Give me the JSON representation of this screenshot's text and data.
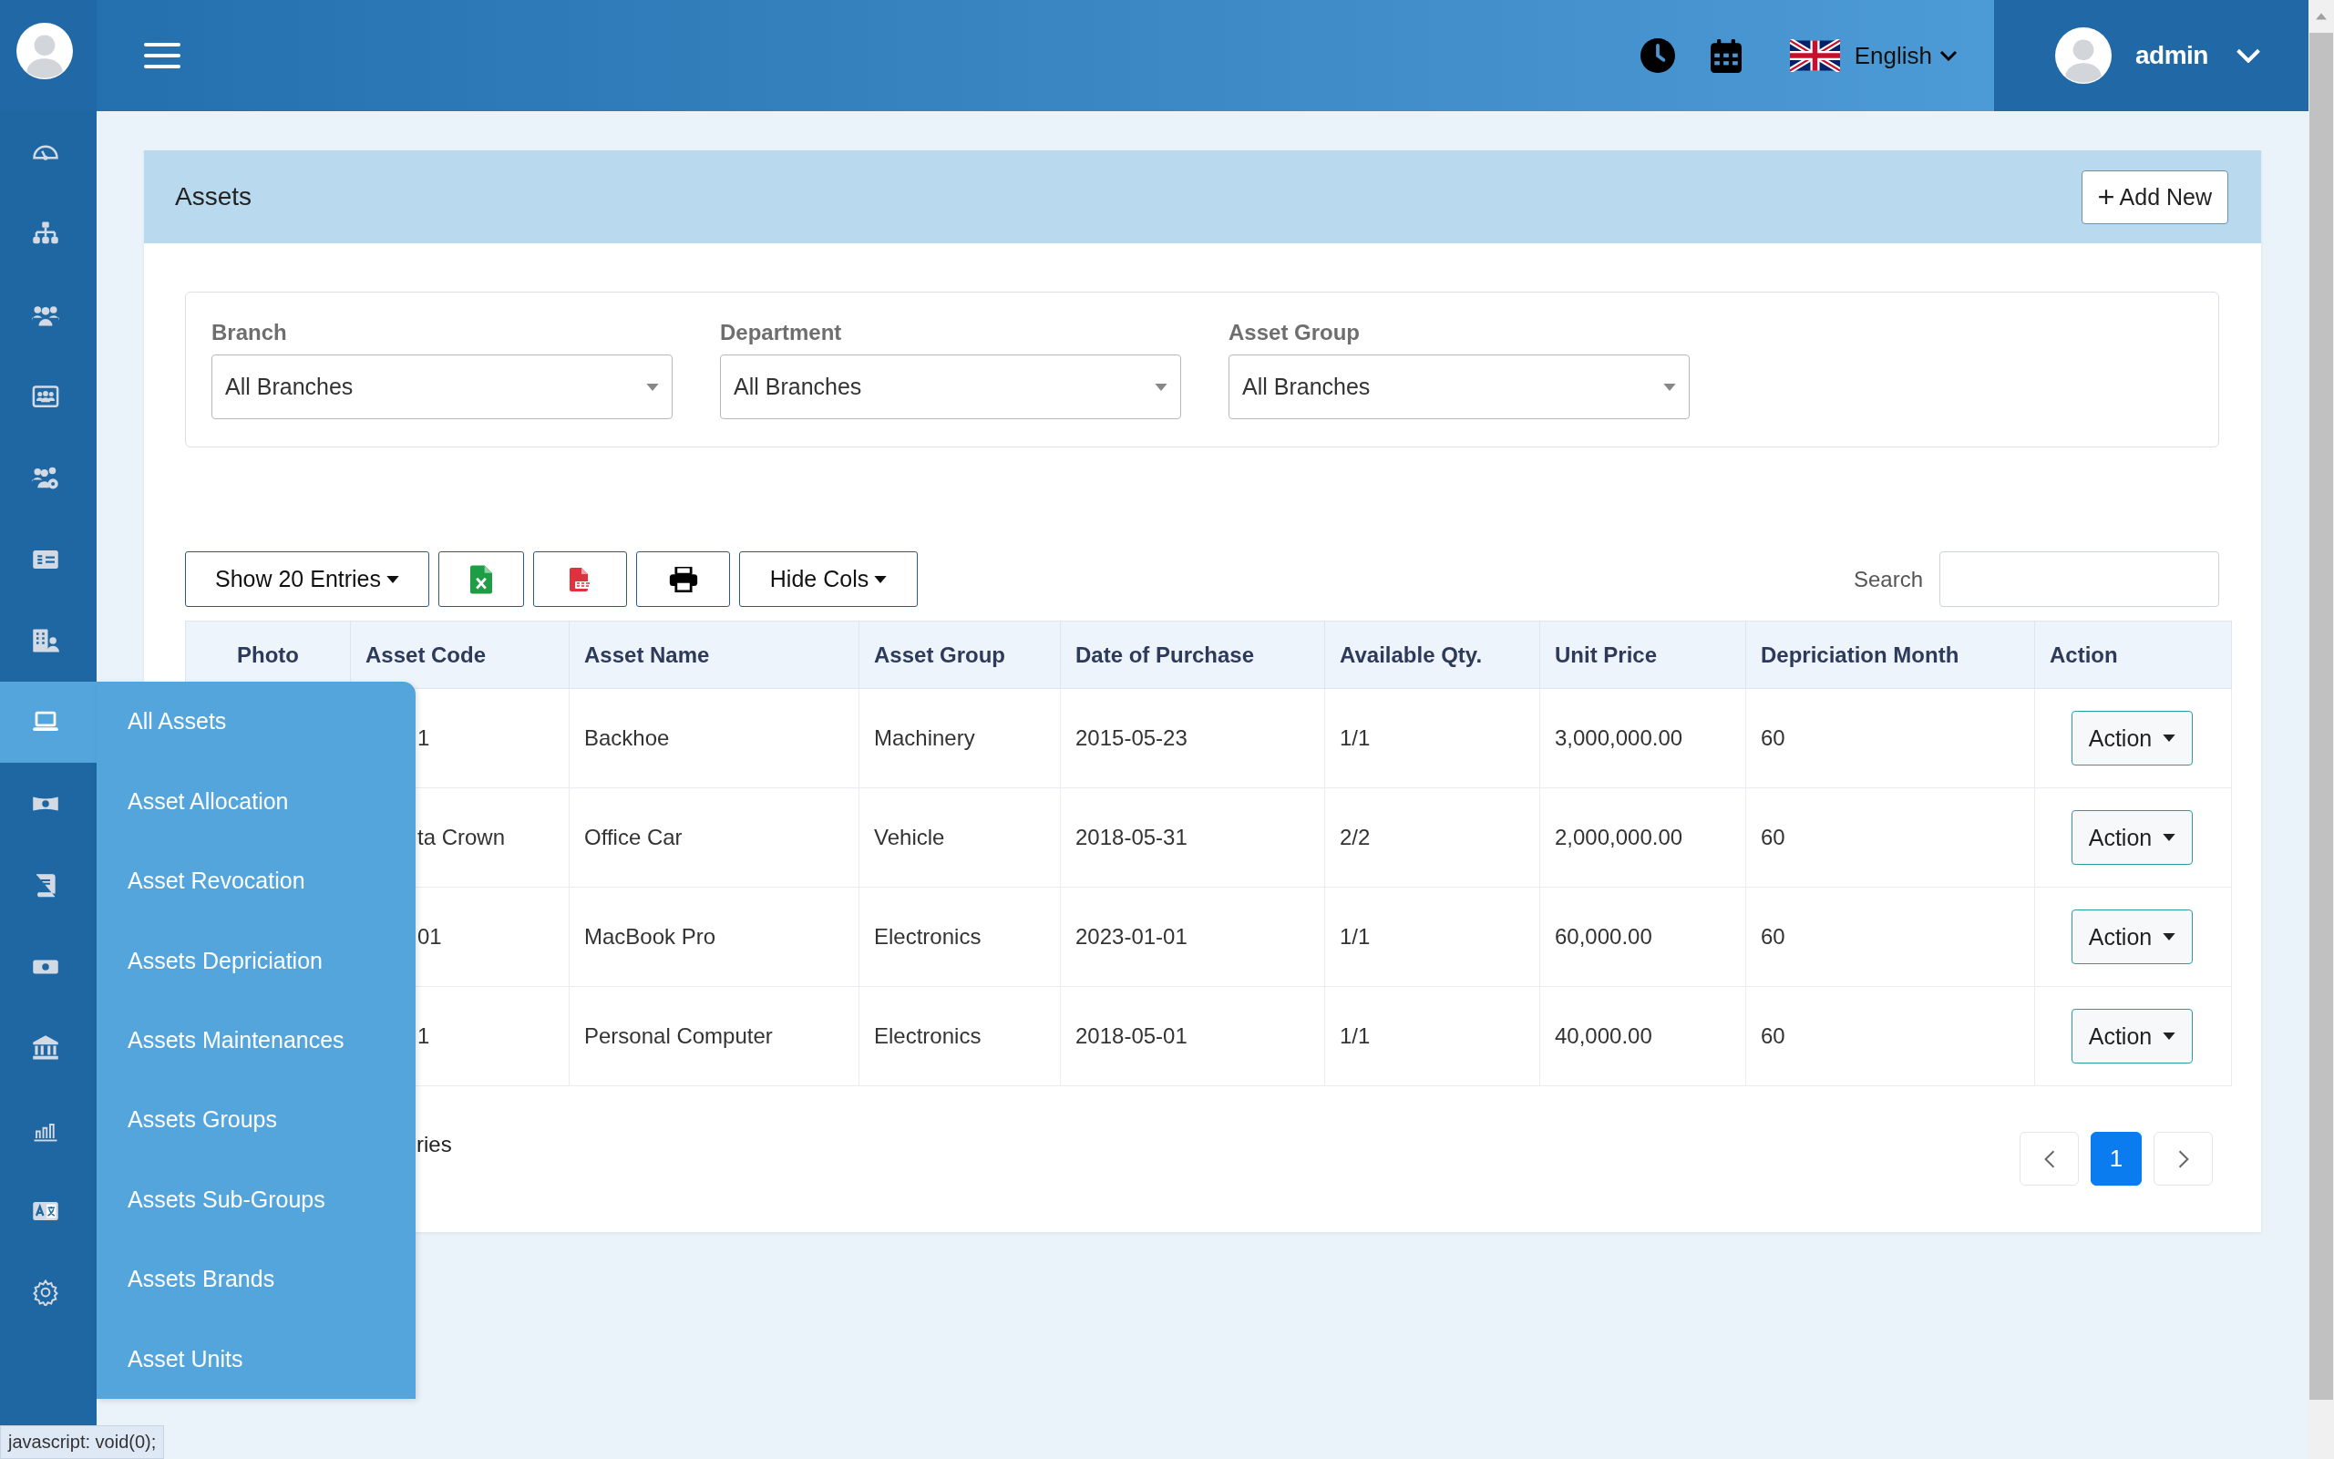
{
  "sidebar": {
    "items": [
      {
        "selected": false
      },
      {
        "selected": false
      },
      {
        "selected": false
      },
      {
        "selected": false
      },
      {
        "selected": false
      },
      {
        "selected": false
      },
      {
        "selected": false
      },
      {
        "selected": true
      },
      {
        "selected": false
      },
      {
        "selected": false
      },
      {
        "selected": false
      },
      {
        "selected": false
      },
      {
        "selected": false
      },
      {
        "selected": false
      },
      {
        "selected": false
      }
    ]
  },
  "topbar": {
    "language": "English",
    "user": "admin"
  },
  "flyout": {
    "items": [
      "All Assets",
      "Asset Allocation",
      "Asset Revocation",
      "Assets Depriciation",
      "Assets Maintenances",
      "Assets Groups",
      "Assets Sub-Groups",
      "Assets Brands",
      "Asset Units"
    ]
  },
  "page": {
    "title": "Assets",
    "add_button": "Add New"
  },
  "filters": [
    {
      "label": "Branch",
      "value": "All Branches"
    },
    {
      "label": "Department",
      "value": "All Branches"
    },
    {
      "label": "Asset Group",
      "value": "All Branches"
    }
  ],
  "toolbar": {
    "entries_button": "Show 20 Entries",
    "hide_cols_button": "Hide Cols",
    "search_label": "Search"
  },
  "table": {
    "columns": [
      "Photo",
      "Asset Code",
      "Asset Name",
      "Asset Group",
      "Date of Purchase",
      "Available Qty.",
      "Unit Price",
      "Depriciation Month",
      "Action"
    ],
    "rows": [
      {
        "cells": [
          "",
          "1",
          "Backhoe",
          "Machinery",
          "2015-05-23",
          "1/1",
          "3,000,000.00",
          "60"
        ],
        "action": "Action"
      },
      {
        "cells": [
          "",
          "ta Crown",
          "Office Car",
          "Vehicle",
          "2018-05-31",
          "2/2",
          "2,000,000.00",
          "60"
        ],
        "action": "Action"
      },
      {
        "cells": [
          "",
          "01",
          "MacBook Pro",
          "Electronics",
          "2023-01-01",
          "1/1",
          "60,000.00",
          "60"
        ],
        "action": "Action"
      },
      {
        "cells": [
          "",
          "1",
          "Personal Computer",
          "Electronics",
          "2018-05-01",
          "1/1",
          "40,000.00",
          "60"
        ],
        "action": "Action"
      }
    ]
  },
  "footer": {
    "info": "ries",
    "pages": [
      {
        "label": "1",
        "selected": true
      }
    ]
  },
  "status_bar": "javascript: void(0);"
}
